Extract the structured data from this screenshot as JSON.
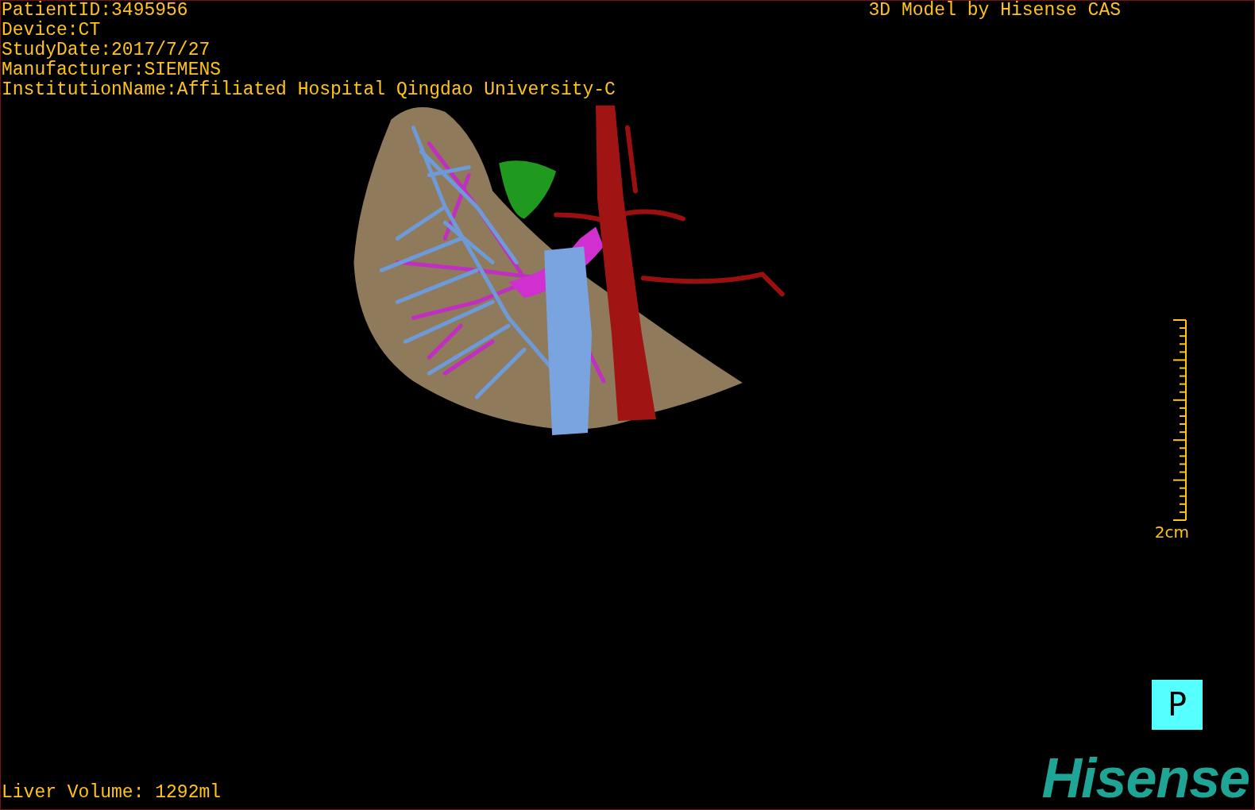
{
  "viewer": {
    "info_lines": [
      "PatientID:3495956",
      "Device:CT",
      "StudyDate:2017/7/27",
      "Manufacturer:SIEMENS",
      "InstitutionName:Affiliated Hospital Qingdao University-C"
    ],
    "title": "3D Model by Hisense CAS",
    "scale": {
      "label": "2cm"
    },
    "liver_volume": "Liver Volume: 1292ml",
    "view_button": {
      "label": "P"
    },
    "logo": "Hisense"
  }
}
